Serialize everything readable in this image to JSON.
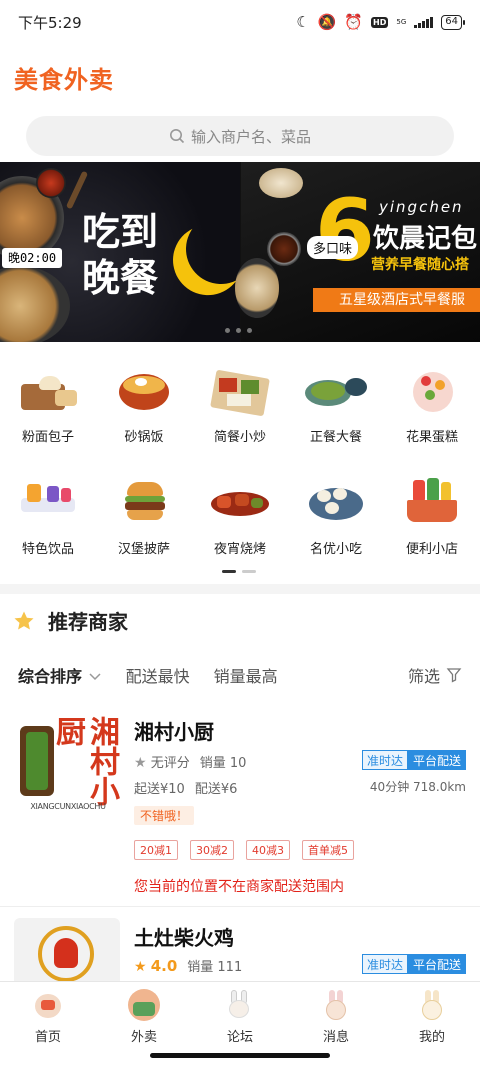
{
  "status_bar": {
    "time": "下午5:29",
    "hd": "HD",
    "network": "5G",
    "battery": "64"
  },
  "header": {
    "title": "美食外卖"
  },
  "search": {
    "placeholder": "输入商户名、菜品"
  },
  "banner": {
    "slide1": {
      "clock": "晚02:00",
      "line1": "吃到",
      "line2": "晚餐"
    },
    "slide2": {
      "number": "6",
      "tag": "多口味",
      "pinyin": "yingchen",
      "title": "饮晨记包",
      "subtitle": "营养早餐随心搭",
      "bar": "五星级酒店式早餐服"
    }
  },
  "categories": [
    [
      {
        "label": "粉面包子",
        "icon": "noodle-bun-icon"
      },
      {
        "label": "砂锅饭",
        "icon": "claypot-rice-icon"
      },
      {
        "label": "简餐小炒",
        "icon": "set-meal-icon"
      },
      {
        "label": "正餐大餐",
        "icon": "feast-icon"
      },
      {
        "label": "花果蛋糕",
        "icon": "cake-icon"
      }
    ],
    [
      {
        "label": "特色饮品",
        "icon": "drinks-icon"
      },
      {
        "label": "汉堡披萨",
        "icon": "burger-icon"
      },
      {
        "label": "夜宵烧烤",
        "icon": "bbq-icon"
      },
      {
        "label": "名优小吃",
        "icon": "snack-icon"
      },
      {
        "label": "便利小店",
        "icon": "store-basket-icon"
      }
    ]
  ],
  "section": {
    "title": "推荐商家"
  },
  "sort": {
    "items": [
      "综合排序",
      "配送最快",
      "销量最高"
    ],
    "filter": "筛选"
  },
  "shops": [
    {
      "name": "湘村小厨",
      "logo_text": "湘村小厨",
      "logo_sub": "XIANGCUNXIAOCHU",
      "rating": "无评分",
      "sales": "销量 10",
      "start_price": "起送¥10",
      "delivery_fee": "配送¥6",
      "badge_ontime": "准时达",
      "badge_platform": "平台配送",
      "time_distance": "40分钟 718.0km",
      "tag": "不错哦！",
      "promos": [
        "20减1",
        "30减2",
        "40减3",
        "首单减5"
      ],
      "warning": "您当前的位置不在商家配送范围内"
    },
    {
      "name": "土灶柴火鸡",
      "rating": "4.0",
      "sales": "销量 111",
      "badge_ontime": "准时达",
      "badge_platform": "平台配送"
    }
  ],
  "bottom_nav": [
    {
      "label": "首页",
      "icon": "home-icon"
    },
    {
      "label": "外卖",
      "icon": "takeout-icon"
    },
    {
      "label": "论坛",
      "icon": "forum-icon"
    },
    {
      "label": "消息",
      "icon": "message-icon"
    },
    {
      "label": "我的",
      "icon": "profile-icon"
    }
  ],
  "colors": {
    "brand": "#f06321",
    "blue": "#2b8de0",
    "red": "#e2231a",
    "star": "#f39a1c"
  }
}
